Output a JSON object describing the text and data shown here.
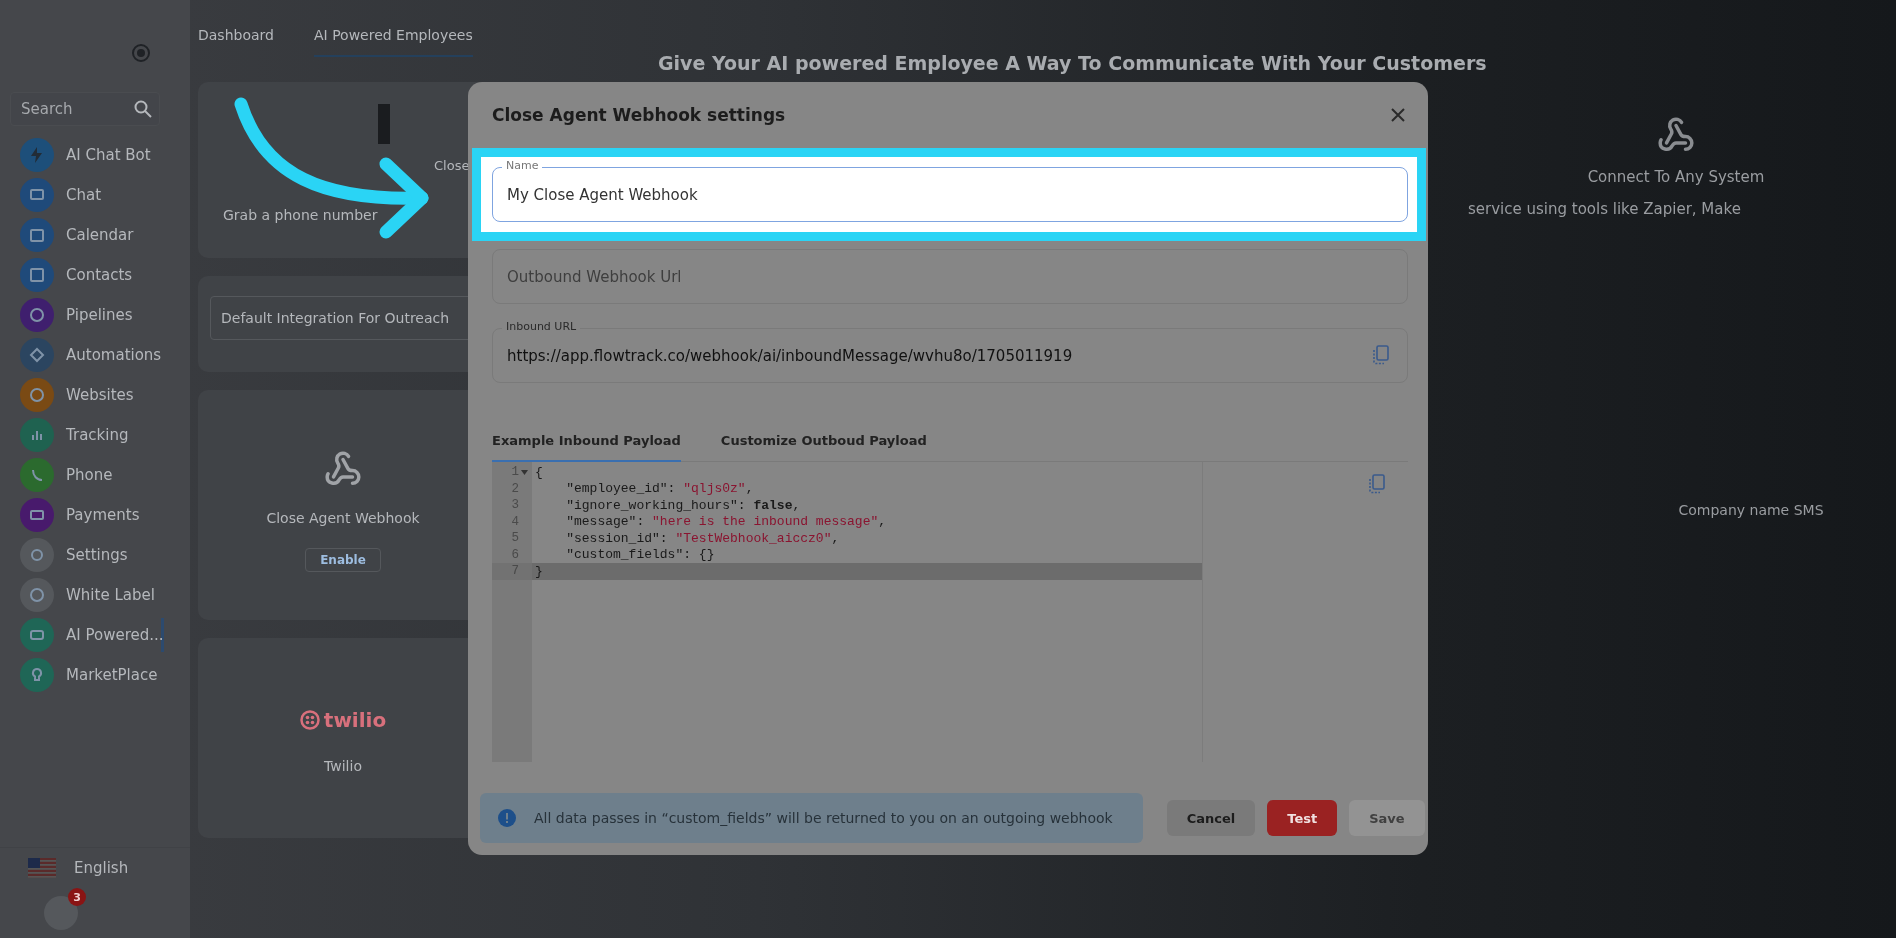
{
  "sidebar": {
    "search": {
      "placeholder": "Search"
    },
    "items": [
      {
        "label": "AI Chat Bot",
        "color": "#1d4f7a",
        "selected": false
      },
      {
        "label": "Chat",
        "color": "#1f4a7a",
        "selected": false
      },
      {
        "label": "Calendar",
        "color": "#1f4a7a",
        "selected": false
      },
      {
        "label": "Contacts",
        "color": "#1f4a7a",
        "selected": false
      },
      {
        "label": "Pipelines",
        "color": "#3f1f6e",
        "selected": false
      },
      {
        "label": "Automations",
        "color": "#2b4560",
        "selected": false
      },
      {
        "label": "Websites",
        "color": "#7a4a14",
        "selected": false
      },
      {
        "label": "Tracking",
        "color": "#1f6250",
        "selected": false
      },
      {
        "label": "Phone",
        "color": "#2b6a2e",
        "selected": false
      },
      {
        "label": "Payments",
        "color": "#481a6c",
        "selected": false
      },
      {
        "label": "Settings",
        "color": "#55585c",
        "selected": false
      },
      {
        "label": "White Label",
        "color": "#55585c",
        "selected": false
      },
      {
        "label": "AI Powered...",
        "color": "#1f6656",
        "selected": true
      },
      {
        "label": "MarketPlace",
        "color": "#1f6656",
        "selected": false
      }
    ],
    "language": "English",
    "notification_badge": "3"
  },
  "top_tabs": [
    {
      "label": "Dashboard",
      "selected": false
    },
    {
      "label": "AI Powered Employees",
      "selected": true
    }
  ],
  "heading": "Give Your AI powered Employee A Way To Communicate With Your Customers",
  "left_cards": [
    {
      "kind": "phone",
      "title": "Close",
      "subtitle": "Grab a phone number"
    },
    {
      "kind": "select",
      "value": "Default Integration For Outreach"
    },
    {
      "kind": "webhook",
      "title": "Close Agent Webhook",
      "button": "Enable"
    },
    {
      "kind": "twilio",
      "logo": "twilio",
      "title": "Twilio"
    }
  ],
  "right_cards": [
    {
      "kind": "webhook",
      "title": "Connect To Any System",
      "subtitle": "service using tools like Zapier, Make"
    },
    {
      "kind": "text",
      "title": "Company name SMS"
    }
  ],
  "modal": {
    "title": "Close Agent Webhook settings",
    "name_field": {
      "label": "Name",
      "value": "My Close Agent Webhook",
      "highlighted": true
    },
    "outbound_field": {
      "placeholder": "Outbound Webhook Url"
    },
    "inbound_field": {
      "label": "Inbound URL",
      "value": "https://app.flowtrack.co/webhook/ai/inboundMessage/wvhu8o/1705011919"
    },
    "tabs": [
      {
        "label": "Example Inbound Payload",
        "selected": true
      },
      {
        "label": "Customize Outboud Payload",
        "selected": false
      }
    ],
    "code_lines": [
      {
        "number": "1",
        "foldable": true,
        "active": false,
        "tokens": [
          {
            "kind": "punct",
            "text": "{"
          }
        ]
      },
      {
        "number": "2",
        "foldable": false,
        "active": false,
        "tokens": [
          {
            "kind": "key",
            "text": "    \"employee_id\": "
          },
          {
            "kind": "string",
            "text": "\"qljs0z\""
          },
          {
            "kind": "punct",
            "text": ","
          }
        ]
      },
      {
        "number": "3",
        "foldable": false,
        "active": false,
        "tokens": [
          {
            "kind": "key",
            "text": "    \"ignore_working_hours\": "
          },
          {
            "kind": "keyword",
            "text": "false"
          },
          {
            "kind": "punct",
            "text": ","
          }
        ]
      },
      {
        "number": "4",
        "foldable": false,
        "active": false,
        "tokens": [
          {
            "kind": "key",
            "text": "    \"message\": "
          },
          {
            "kind": "string",
            "text": "\"here is the inbound message\""
          },
          {
            "kind": "punct",
            "text": ","
          }
        ]
      },
      {
        "number": "5",
        "foldable": false,
        "active": false,
        "tokens": [
          {
            "kind": "key",
            "text": "    \"session_id\": "
          },
          {
            "kind": "string",
            "text": "\"TestWebhook_aiccz0\""
          },
          {
            "kind": "punct",
            "text": ","
          }
        ]
      },
      {
        "number": "6",
        "foldable": false,
        "active": false,
        "tokens": [
          {
            "kind": "key",
            "text": "    \"custom_fields\": {}"
          }
        ]
      },
      {
        "number": "7",
        "foldable": false,
        "active": true,
        "tokens": [
          {
            "kind": "punct",
            "text": "}"
          }
        ]
      }
    ],
    "info": "All data passes in “custom_fields” will be returned to you on an outgoing webhook",
    "buttons": [
      {
        "kind": "cancel",
        "label": "Cancel",
        "disabled": false
      },
      {
        "kind": "test",
        "label": "Test",
        "disabled": false
      },
      {
        "kind": "save",
        "label": "Save",
        "disabled": true
      }
    ]
  }
}
